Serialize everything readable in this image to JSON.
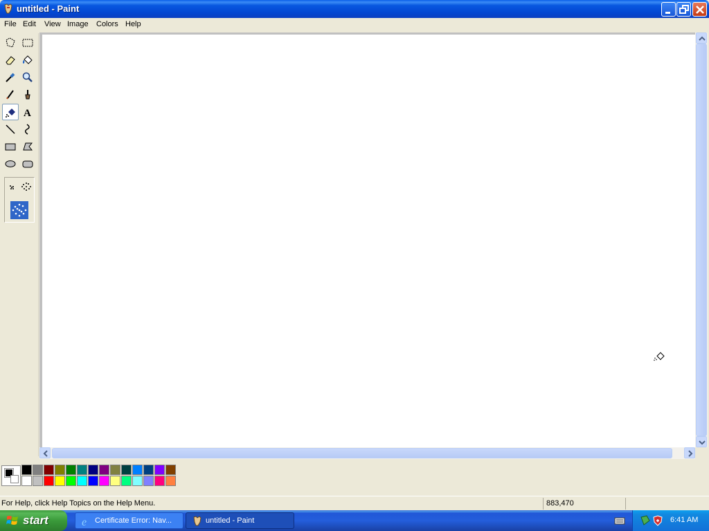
{
  "window": {
    "title": "untitled - Paint"
  },
  "menu": {
    "items": [
      {
        "id": "file",
        "label": "File"
      },
      {
        "id": "edit",
        "label": "Edit"
      },
      {
        "id": "view",
        "label": "View"
      },
      {
        "id": "image",
        "label": "Image"
      },
      {
        "id": "colors",
        "label": "Colors"
      },
      {
        "id": "help",
        "label": "Help"
      }
    ]
  },
  "tools": [
    {
      "name": "free-form-select-tool-icon"
    },
    {
      "name": "select-tool-icon"
    },
    {
      "name": "eraser-tool-icon"
    },
    {
      "name": "fill-with-color-tool-icon"
    },
    {
      "name": "pick-color-tool-icon"
    },
    {
      "name": "magnifier-tool-icon"
    },
    {
      "name": "pencil-tool-icon"
    },
    {
      "name": "brush-tool-icon"
    },
    {
      "name": "airbrush-tool-icon",
      "selected": true
    },
    {
      "name": "text-tool-icon"
    },
    {
      "name": "line-tool-icon"
    },
    {
      "name": "curve-tool-icon"
    },
    {
      "name": "rectangle-tool-icon"
    },
    {
      "name": "polygon-tool-icon"
    },
    {
      "name": "ellipse-tool-icon"
    },
    {
      "name": "rounded-rectangle-tool-icon"
    }
  ],
  "airbrush_options": [
    "small-spray-icon",
    "medium-spray-icon",
    "large-spray-icon"
  ],
  "palette": {
    "foreground": "#000000",
    "background": "#ffffff",
    "top_row": [
      "#000000",
      "#808080",
      "#800000",
      "#808000",
      "#008000",
      "#008080",
      "#000080",
      "#800080",
      "#808040",
      "#004040",
      "#0080ff",
      "#004080",
      "#8000ff",
      "#804000"
    ],
    "bottom_row": [
      "#ffffff",
      "#c0c0c0",
      "#ff0000",
      "#ffff00",
      "#00ff00",
      "#00ffff",
      "#0000ff",
      "#ff00ff",
      "#ffff80",
      "#00ff80",
      "#80ffff",
      "#8080ff",
      "#ff0080",
      "#ff8040"
    ]
  },
  "status": {
    "help_text": "For Help, click Help Topics on the Help Menu.",
    "coordinates": "883,470"
  },
  "taskbar": {
    "start_label": "start",
    "tasks": [
      {
        "label": "Certificate Error: Nav...",
        "icon": "internet-explorer-icon",
        "active": false
      },
      {
        "label": "untitled - Paint",
        "icon": "paint-app-icon",
        "active": true
      }
    ],
    "clock": "6:41 AM"
  }
}
